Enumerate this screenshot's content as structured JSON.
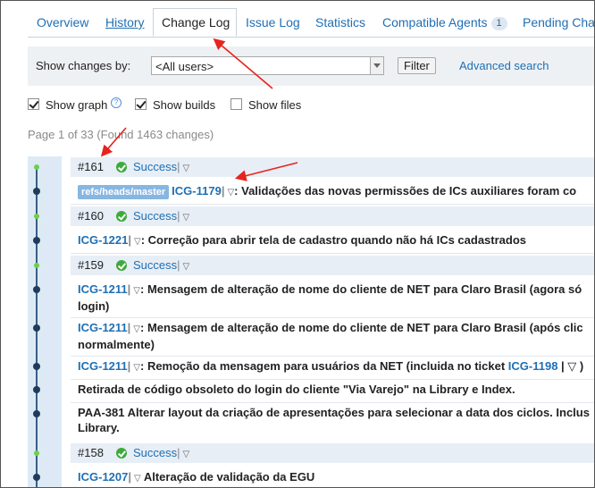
{
  "tabs": [
    {
      "label": "Overview"
    },
    {
      "label": "History"
    },
    {
      "label": "Change Log"
    },
    {
      "label": "Issue Log"
    },
    {
      "label": "Statistics"
    },
    {
      "label": "Compatible Agents",
      "badge": "1"
    },
    {
      "label": "Pending Char"
    }
  ],
  "filter": {
    "label": "Show changes by:",
    "select_value": "<All users>",
    "button": "Filter",
    "advanced": "Advanced search"
  },
  "options": {
    "show_graph": "Show graph",
    "show_builds": "Show builds",
    "show_files": "Show files",
    "help": "?"
  },
  "pager": "Page 1 of 33 (Found 1463 changes)",
  "builds": [
    {
      "num": "#161",
      "status": "Success",
      "sep": "|",
      "tri": "▽"
    },
    {
      "num": "#160",
      "status": "Success",
      "sep": "|",
      "tri": "▽"
    },
    {
      "num": "#159",
      "status": "Success",
      "sep": "|",
      "tri": "▽"
    },
    {
      "num": "#158",
      "status": "Success",
      "sep": "|",
      "tri": "▽"
    }
  ],
  "changes": [
    {
      "branch": "refs/heads/master",
      "ref": "ICG-1179",
      "sep": "|",
      "tri": "▽",
      "text": ": Validações das novas permissões de ICs auxiliares foram co"
    },
    {
      "ref": "ICG-1221",
      "sep": "|",
      "tri": "▽",
      "text": ": Correção para abrir tela de cadastro quando não há ICs cadastrados"
    },
    {
      "ref": "ICG-1211",
      "sep": "|",
      "tri": "▽",
      "text": ": Mensagem de alteração de nome do cliente de NET para Claro Brasil (agora só",
      "text2": "login)"
    },
    {
      "ref": "ICG-1211",
      "sep": "|",
      "tri": "▽",
      "text": ": Mensagem de alteração de nome do cliente de NET para Claro Brasil (após clic",
      "text2": "normalmente)"
    },
    {
      "ref": "ICG-1211",
      "sep": "|",
      "tri": "▽",
      "text": ": Remoção da mensagem para usuários da NET (incluida no ticket ",
      "ref2": "ICG-1198",
      "tail": " | ▽ )"
    },
    {
      "text": "Retirada de código obsoleto do login do cliente \"Via Varejo\" na Library e Index."
    },
    {
      "text": "PAA-381 Alterar layout da criação de apresentações para selecionar a data dos ciclos. Inclus",
      "text2": "Library."
    },
    {
      "ref": "ICG-1207",
      "sep": "|",
      "tri": "▽",
      "text": "  Alteração de validação da EGU"
    }
  ],
  "colors": {
    "link": "#1f6fb4",
    "graph_bg": "#ddeaf6",
    "build_bg": "#e7eef6",
    "success": "#3eaa3b",
    "arrow": "#e8231e",
    "branch": "#87b6e2"
  }
}
